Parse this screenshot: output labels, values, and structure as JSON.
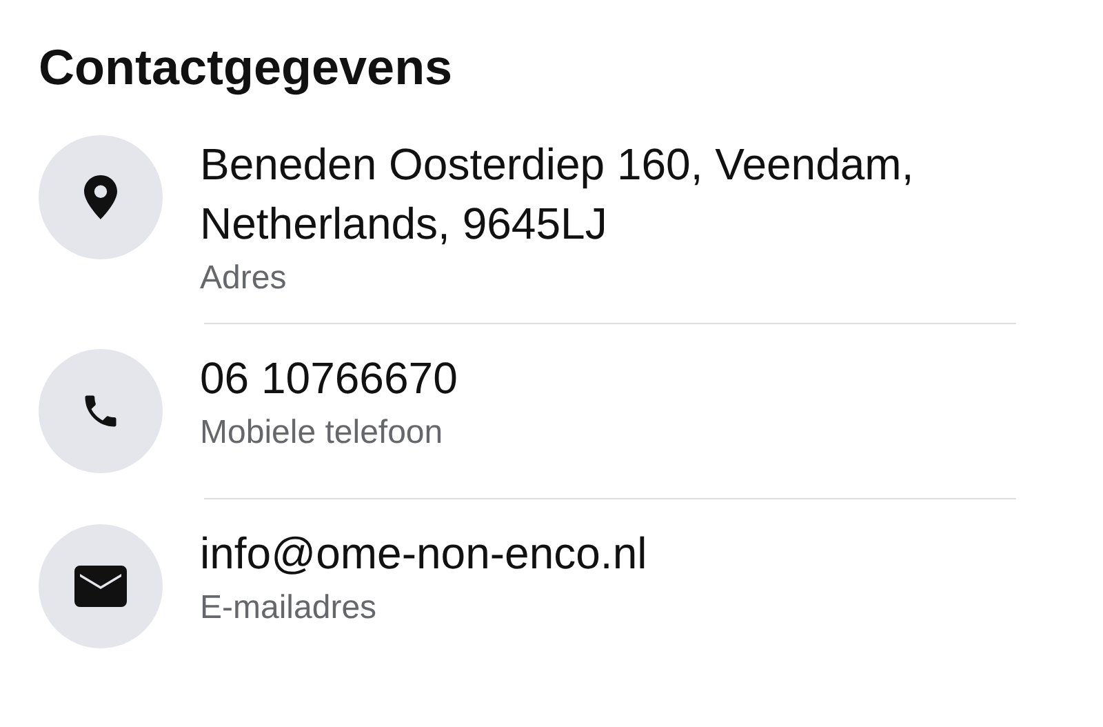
{
  "title": "Contactgegevens",
  "items": [
    {
      "kind": "location",
      "value": "Beneden Oosterdiep 160, Veendam, Netherlands, 9645LJ",
      "label": "Adres"
    },
    {
      "kind": "phone",
      "value": "06 10766670",
      "label": "Mobiele telefoon"
    },
    {
      "kind": "email",
      "value": "info@ome-non-enco.nl",
      "label": "E-mailadres"
    }
  ]
}
